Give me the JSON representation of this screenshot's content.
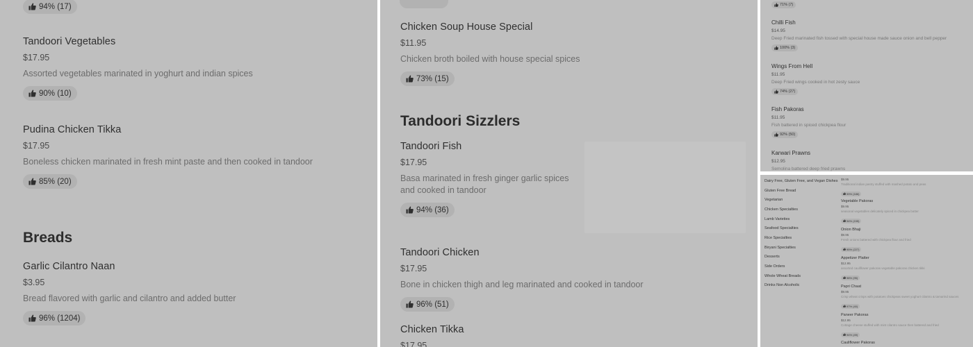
{
  "panel1": {
    "top_badge": "94% (17)",
    "items": [
      {
        "name": "Tandoori Vegetables",
        "price": "$17.95",
        "desc": "Assorted vegetables marinated in yoghurt and indian spices",
        "rating": "90% (10)"
      },
      {
        "name": "Pudina Chicken Tikka",
        "price": "$17.95",
        "desc": "Boneless chicken marinated in fresh mint paste and then cooked in tandoor",
        "rating": "85% (20)"
      }
    ],
    "section_title": "Breads",
    "section_items": [
      {
        "name": "Garlic Cilantro Naan",
        "price": "$3.95",
        "desc": "Bread flavored with garlic and cilantro and added butter",
        "rating": "96% (1204)"
      }
    ]
  },
  "panel2": {
    "items": [
      {
        "name": "Chicken Soup House Special",
        "price": "$11.95",
        "desc": "Chicken broth boiled with house special spices",
        "rating": "73% (15)"
      }
    ],
    "section_title": "Tandoori Sizzlers",
    "section_items": [
      {
        "name": "Tandoori Fish",
        "price": "$17.95",
        "desc_line1": "Basa marinated in fresh ginger garlic spices",
        "desc_line2": "and cooked in tandoor",
        "rating": "94% (36)"
      },
      {
        "name": "Tandoori Chicken",
        "price": "$17.95",
        "desc": "Bone in chicken thigh and leg marinated and cooked in tandoor",
        "rating": "96% (51)"
      },
      {
        "name": "Chicken Tikka",
        "price": "$17.95"
      }
    ]
  },
  "panel3": {
    "top_badge": "71% (7)",
    "items": [
      {
        "name": "Chilli Fish",
        "price": "$14.95",
        "desc": "Deep Fried marinated fish tossed with special house made sauce onion and bell pepper",
        "rating": "100% (3)"
      },
      {
        "name": "Wings From Hell",
        "price": "$11.95",
        "desc": "Deep Fried wings cooked in hot zesty sauce",
        "rating": "74% (27)"
      },
      {
        "name": "Fish Pakoras",
        "price": "$11.95",
        "desc": "Fish battered in spiced chickpea flour",
        "rating": "92% (50)"
      },
      {
        "name": "Karwari Prawns",
        "price": "$12.95",
        "desc": "Semolina battered deep fried prawns"
      }
    ]
  },
  "panel4": {
    "categories": [
      "Dairy Free, Gluten Free, and Vegan Dishes",
      "Gluten Free Bread",
      "Vegetarian",
      "Chicken Specialties",
      "Lamb Varieties",
      "Seafood Specialties",
      "Rice Specialties",
      "Biryani Specialties",
      "Desserts",
      "Side Orders",
      "Whole Wheat Breads",
      "Drinks Non Alcoholic"
    ],
    "top_item": {
      "price": "$9.95",
      "desc": "Traditional indian pastry stuffed with mashed potato and peas",
      "rating": "99% (186)"
    },
    "items": [
      {
        "name": "Vegetable Pakoras",
        "price": "$9.95",
        "desc": "seasonal vegetables delicately spiced in chickpea batter",
        "rating": "94% (155)"
      },
      {
        "name": "Onion Bhaji",
        "price": "$9.95",
        "desc": "Fresh onions battered with chickpea flour and fried",
        "rating": "95% (227)"
      },
      {
        "name": "Appetizer Platter",
        "price": "$12.95",
        "desc": "assorted cauliflower pakoras vegetable pakoras chicken tikki",
        "rating": "98% (95)"
      },
      {
        "name": "Papri Chaat",
        "price": "$9.95",
        "desc": "Crisp wheat crisps with potatoes chickpeas sweet yoghurt cilantro & tamarind sauces",
        "rating": "97% (40)"
      },
      {
        "name": "Paneer Pakoras",
        "price": "$12.95",
        "desc": "Cottage cheese stuffed with mint cilantro sauce then battered and fried",
        "rating": "94% (49)"
      },
      {
        "name": "Cauliflower Pakoras"
      }
    ]
  }
}
